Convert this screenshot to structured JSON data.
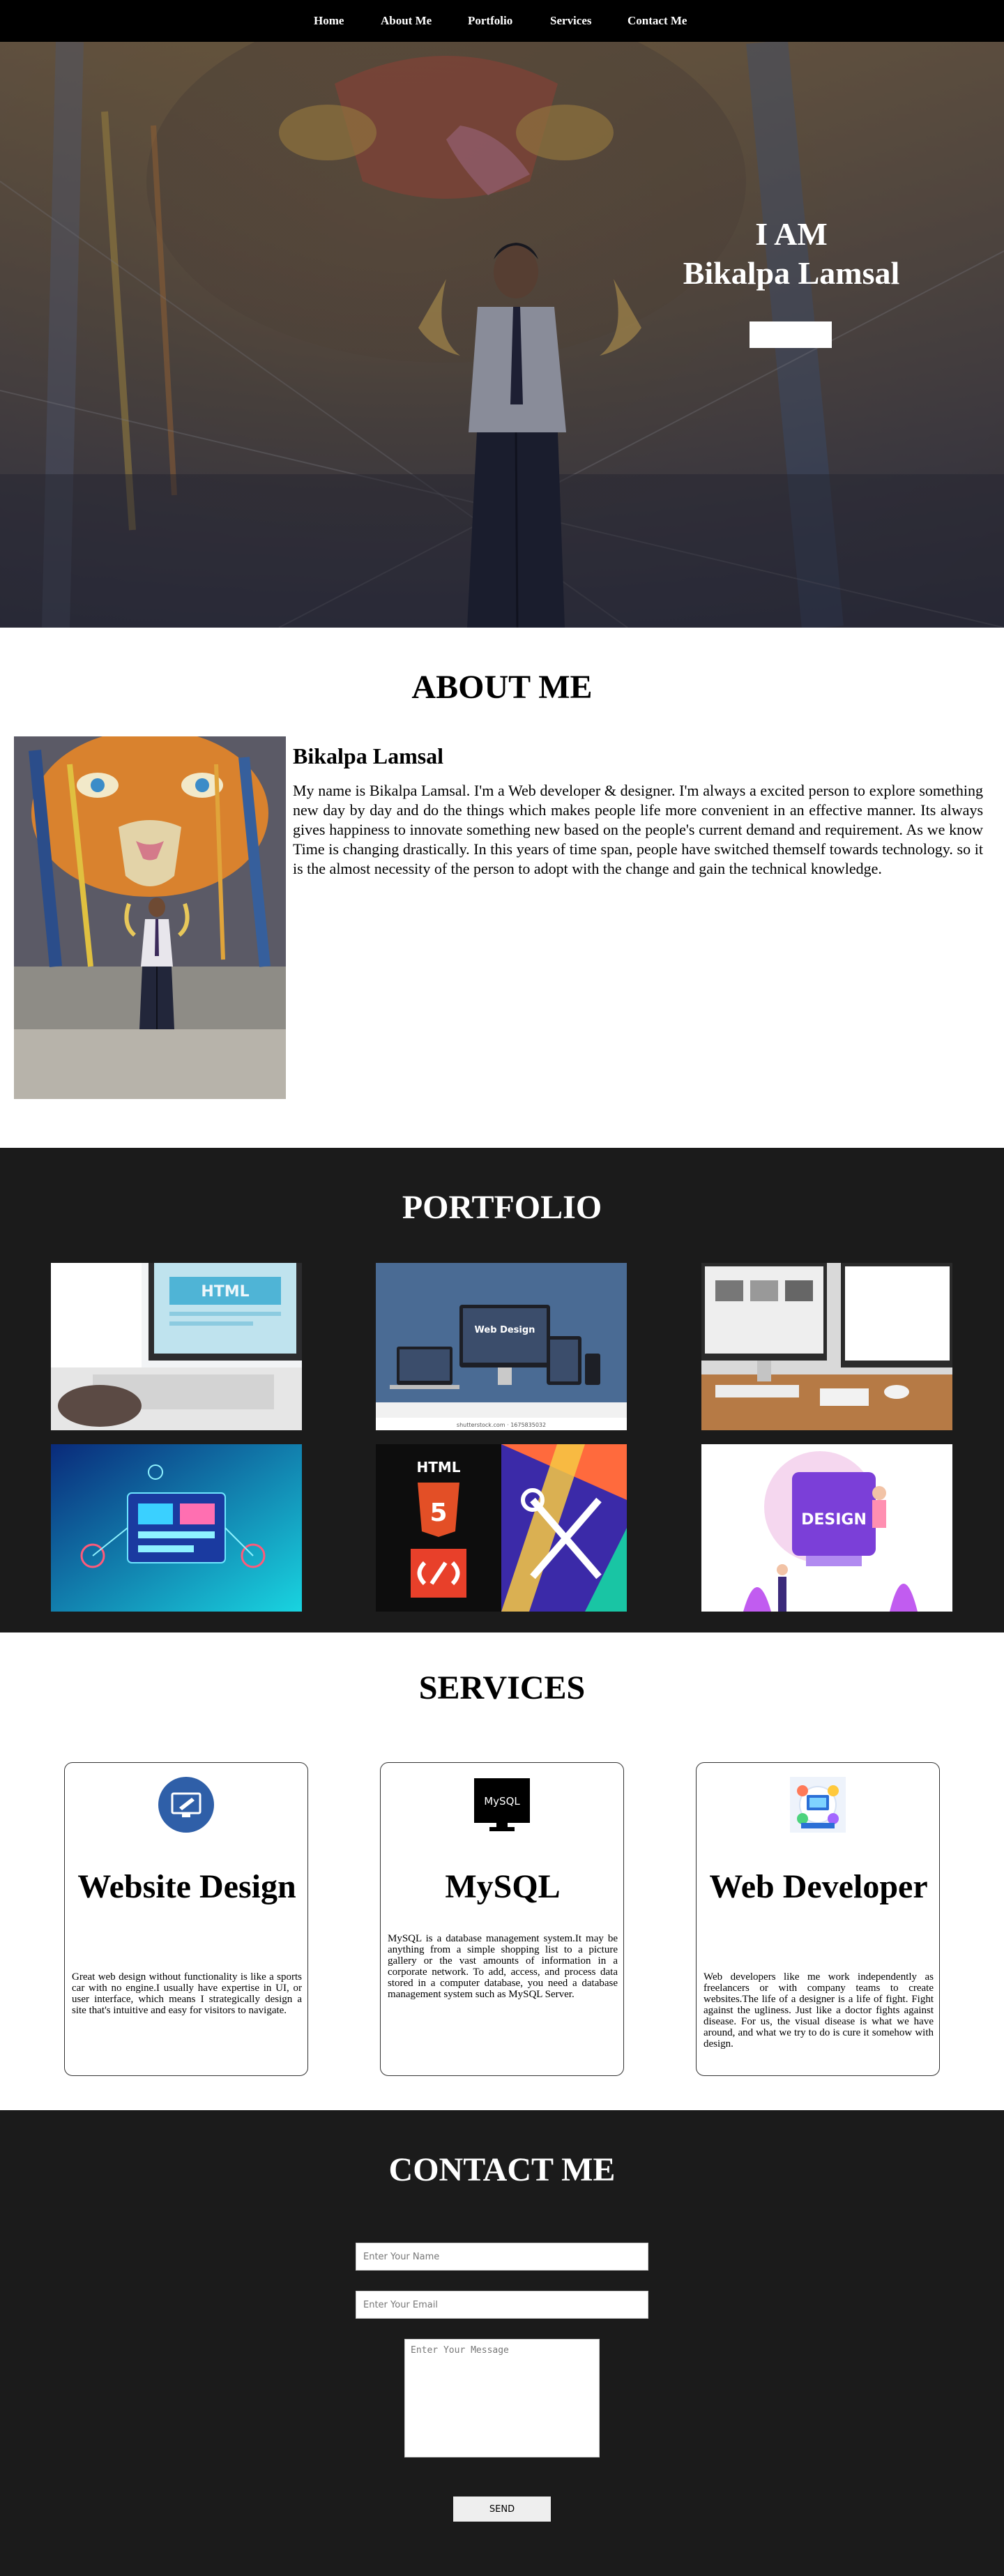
{
  "nav": {
    "items": [
      {
        "label": "Home"
      },
      {
        "label": "About Me"
      },
      {
        "label": "Portfolio"
      },
      {
        "label": "Services"
      },
      {
        "label": "Contact Me"
      }
    ]
  },
  "hero": {
    "line1": "I AM",
    "line2": "Bikalpa Lamsal",
    "cta_label": ""
  },
  "about": {
    "title": "ABOUT ME",
    "name": "Bikalpa Lamsal",
    "text": "My name is Bikalpa Lamsal. I'm a Web developer & designer. I'm always a excited person to explore something new day by day and do the things which makes people life more convenient in an effective manner. Its always gives happiness to innovate something new based on the people's current demand and requirement. As we know Time is changing drastically. In this years of time span, people have switched themself towards technology. so it is the almost necessity of the person to adopt with the change and gain the technical knowledge."
  },
  "portfolio": {
    "title": "PORTFOLIO",
    "items": [
      {
        "label": "HTML",
        "icon": "html-monitor-image"
      },
      {
        "label": "Web Design",
        "sub": "shutterstock.com · 1675835032",
        "icon": "web-design-devices-image"
      },
      {
        "label": "",
        "icon": "desk-monitor-image"
      },
      {
        "label": "",
        "icon": "tech-dashboard-image"
      },
      {
        "label": "HTML",
        "sub": "5",
        "icon": "html5-css-tools-image"
      },
      {
        "label": "DESIGN",
        "icon": "design-illustration-image"
      }
    ]
  },
  "services": {
    "title": "SERVICES",
    "cards": [
      {
        "title": "Website Design",
        "text": "Great web design without functionality is like a sports car with no engine.I usually have expertise in UI, or user interface, which means I strategically design a site that's intuitive and easy for visitors to navigate."
      },
      {
        "title": "MySQL",
        "icon_label": "MySQL",
        "text": "MySQL is a database management system.It may be anything from a simple shopping list to a picture gallery or the vast amounts of information in a corporate network. To add, access, and process data stored in a computer database, you need a database management system such as MySQL Server."
      },
      {
        "title": "Web Developer",
        "text": "Web developers like me work independently as freelancers or with company teams to create websites.The life of a designer is a life of fight. Fight against the ugliness. Just like a doctor fights against disease. For us, the visual disease is what we have around, and what we try to do is cure it somehow with design."
      }
    ]
  },
  "contact": {
    "title": "CONTACT ME",
    "name_placeholder": "Enter Your Name",
    "email_placeholder": "Enter Your Email",
    "message_placeholder": "Enter Your Message",
    "send_label": "SEND"
  }
}
